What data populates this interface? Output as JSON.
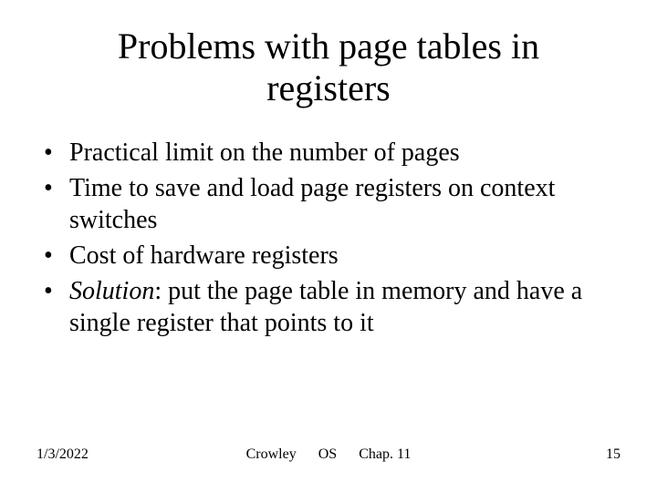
{
  "slide": {
    "title": "Problems with page tables in registers",
    "bullets": [
      {
        "text": "Practical limit on the number of pages"
      },
      {
        "text": "Time to save and load page registers on context switches"
      },
      {
        "text": "Cost of hardware registers"
      },
      {
        "solution_label": "Solution",
        "text": ": put the page table in memory and have a single register that points to it"
      }
    ],
    "footer": {
      "date": "1/3/2022",
      "author": "Crowley",
      "course": "OS",
      "chapter": "Chap. 11",
      "page": "15"
    }
  }
}
